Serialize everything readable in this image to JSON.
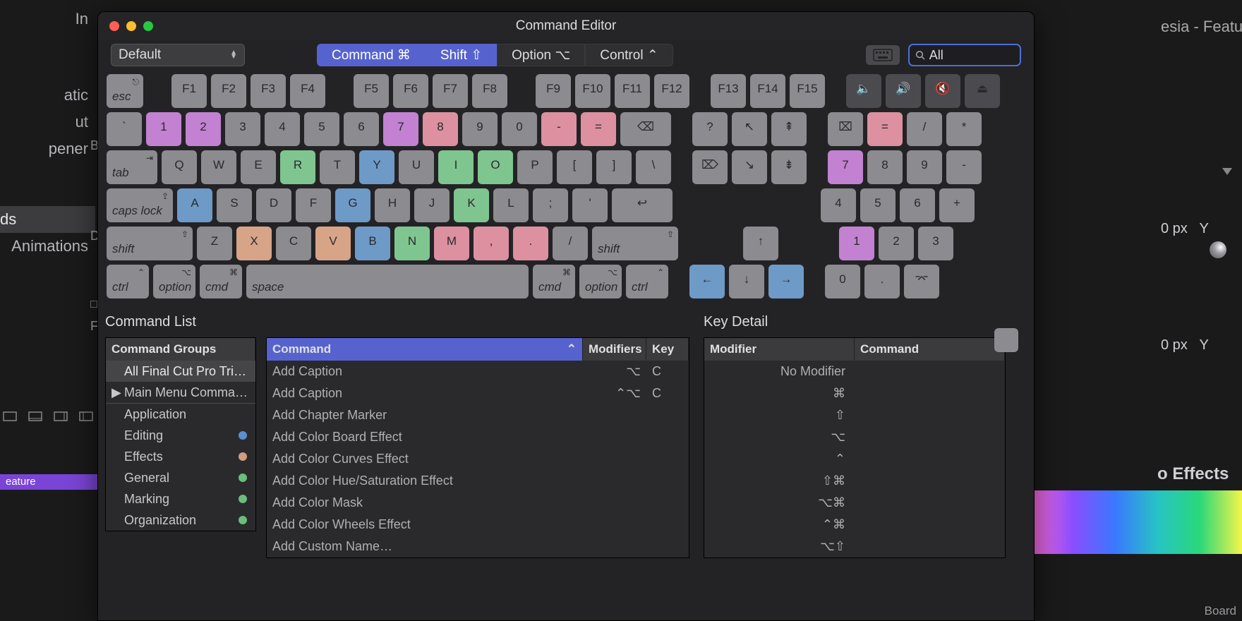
{
  "bg": {
    "in": "In",
    "atic": "atic",
    "ut": "ut",
    "pener": "pener",
    "ds": "ds",
    "anim": "Animations",
    "B": "B",
    "D": "D",
    "F": "F",
    "esia": "esia  -  Feature",
    "feature_tab": "eature",
    "px": "0 px",
    "Y": "Y",
    "eff": "o Effects",
    "board": "Board"
  },
  "window": {
    "title": "Command Editor"
  },
  "preset": {
    "label": "Default"
  },
  "modifiers": {
    "cmd": "Command ⌘",
    "shift": "Shift ⇧",
    "opt": "Option ⌥",
    "ctrl": "Control ⌃"
  },
  "search": {
    "value": "All"
  },
  "kb": {
    "esc": "esc",
    "f1": "F1",
    "f2": "F2",
    "f3": "F3",
    "f4": "F4",
    "f5": "F5",
    "f6": "F6",
    "f7": "F7",
    "f8": "F8",
    "f9": "F9",
    "f10": "F10",
    "f11": "F11",
    "f12": "F12",
    "f13": "F13",
    "f14": "F14",
    "f15": "F15",
    "grave": "`",
    "1": "1",
    "2": "2",
    "3": "3",
    "4": "4",
    "5": "5",
    "6": "6",
    "7": "7",
    "8": "8",
    "9": "9",
    "0": "0",
    "minus": "-",
    "eq": "=",
    "tab": "tab",
    "q": "Q",
    "w": "W",
    "e": "E",
    "r": "R",
    "t": "T",
    "y": "Y",
    "u": "U",
    "i": "I",
    "o": "O",
    "p": "P",
    "lbr": "[",
    "rbr": "]",
    "bsl": "\\",
    "caps": "caps lock",
    "a": "A",
    "s": "S",
    "d": "D",
    "f": "F",
    "g": "G",
    "h": "H",
    "j": "J",
    "k": "K",
    "l": "L",
    "semi": ";",
    "quote": "'",
    "lshift": "shift",
    "z": "Z",
    "x": "X",
    "c": "C",
    "v": "V",
    "b": "B",
    "n": "N",
    "m": "M",
    "comma": ",",
    "period": ".",
    "slash": "/",
    "rshift": "shift",
    "lctrl": "ctrl",
    "lopt": "option",
    "lcmd": "cmd",
    "space": "space",
    "rcmd": "cmd",
    "ropt": "option",
    "rctrl": "ctrl",
    "up": "↑",
    "left": "←",
    "down": "↓",
    "right": "→",
    "ques": "?",
    "np_eq": "=",
    "np_slash": "/",
    "np_star": "*",
    "np7": "7",
    "np8": "8",
    "np9": "9",
    "np_minus": "-",
    "np4": "4",
    "np5": "5",
    "np6": "6",
    "np_plus": "+",
    "np1": "1",
    "np2": "2",
    "np3": "3",
    "np0": "0",
    "np_dot": "."
  },
  "panel": {
    "command_list": "Command List",
    "key_detail": "Key Detail",
    "groups_header": "Command Groups",
    "cmd_header": "Command",
    "mod_header": "Modifiers",
    "key_header": "Key",
    "kd_modifier": "Modifier",
    "kd_command": "Command"
  },
  "groups": [
    {
      "label": "All Final Cut Pro Tri…",
      "sel": true,
      "arrow": false
    },
    {
      "label": "Main Menu Comma…",
      "sel": false,
      "arrow": true
    }
  ],
  "categories": [
    {
      "label": "Application",
      "dot": ""
    },
    {
      "label": "Editing",
      "dot": "#5a8fd0"
    },
    {
      "label": "Effects",
      "dot": "#d29b82"
    },
    {
      "label": "General",
      "dot": "#6bbd7a"
    },
    {
      "label": "Marking",
      "dot": "#6bbd7a"
    },
    {
      "label": "Organization",
      "dot": "#6bbd7a"
    }
  ],
  "commands": [
    {
      "cmd": "Add Caption",
      "mod": "⌥",
      "key": "C"
    },
    {
      "cmd": "Add Caption",
      "mod": "⌃⌥",
      "key": "C"
    },
    {
      "cmd": "Add Chapter Marker",
      "mod": "",
      "key": ""
    },
    {
      "cmd": "Add Color Board Effect",
      "mod": "",
      "key": ""
    },
    {
      "cmd": "Add Color Curves Effect",
      "mod": "",
      "key": ""
    },
    {
      "cmd": "Add Color Hue/Saturation Effect",
      "mod": "",
      "key": ""
    },
    {
      "cmd": "Add Color Mask",
      "mod": "",
      "key": ""
    },
    {
      "cmd": "Add Color Wheels Effect",
      "mod": "",
      "key": ""
    },
    {
      "cmd": "Add Custom Name…",
      "mod": "",
      "key": ""
    }
  ],
  "keydetail": [
    {
      "mod": "No Modifier",
      "cmd": ""
    },
    {
      "mod": "⌘",
      "cmd": ""
    },
    {
      "mod": "⇧",
      "cmd": ""
    },
    {
      "mod": "⌥",
      "cmd": ""
    },
    {
      "mod": "⌃",
      "cmd": ""
    },
    {
      "mod": "⇧⌘",
      "cmd": ""
    },
    {
      "mod": "⌥⌘",
      "cmd": ""
    },
    {
      "mod": "⌃⌘",
      "cmd": ""
    },
    {
      "mod": "⌥⇧",
      "cmd": ""
    }
  ]
}
